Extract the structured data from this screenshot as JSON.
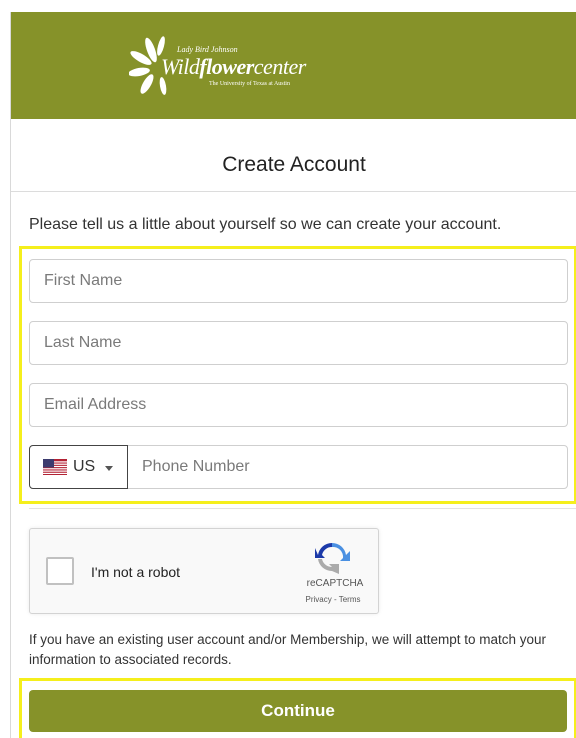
{
  "logo": {
    "small": "Lady Bird Johnson",
    "main_regular": "Wild",
    "main_bold": "flower",
    "main_end": "center",
    "sub": "The University of Texas at Austin"
  },
  "page": {
    "title": "Create Account",
    "intro": "Please tell us a little about yourself so we can create your account."
  },
  "form": {
    "first_name_placeholder": "First Name",
    "last_name_placeholder": "Last Name",
    "email_placeholder": "Email Address",
    "country_code": "US",
    "phone_placeholder": "Phone Number"
  },
  "captcha": {
    "label": "I'm not a robot",
    "brand": "reCAPTCHA",
    "links": "Privacy - Terms"
  },
  "note": "If you have an existing user account and/or Membership, we will attempt to match your information to associated records.",
  "continue_label": "Continue",
  "colors": {
    "brand_green": "#869229",
    "highlight_yellow": "#f5ef1c"
  }
}
